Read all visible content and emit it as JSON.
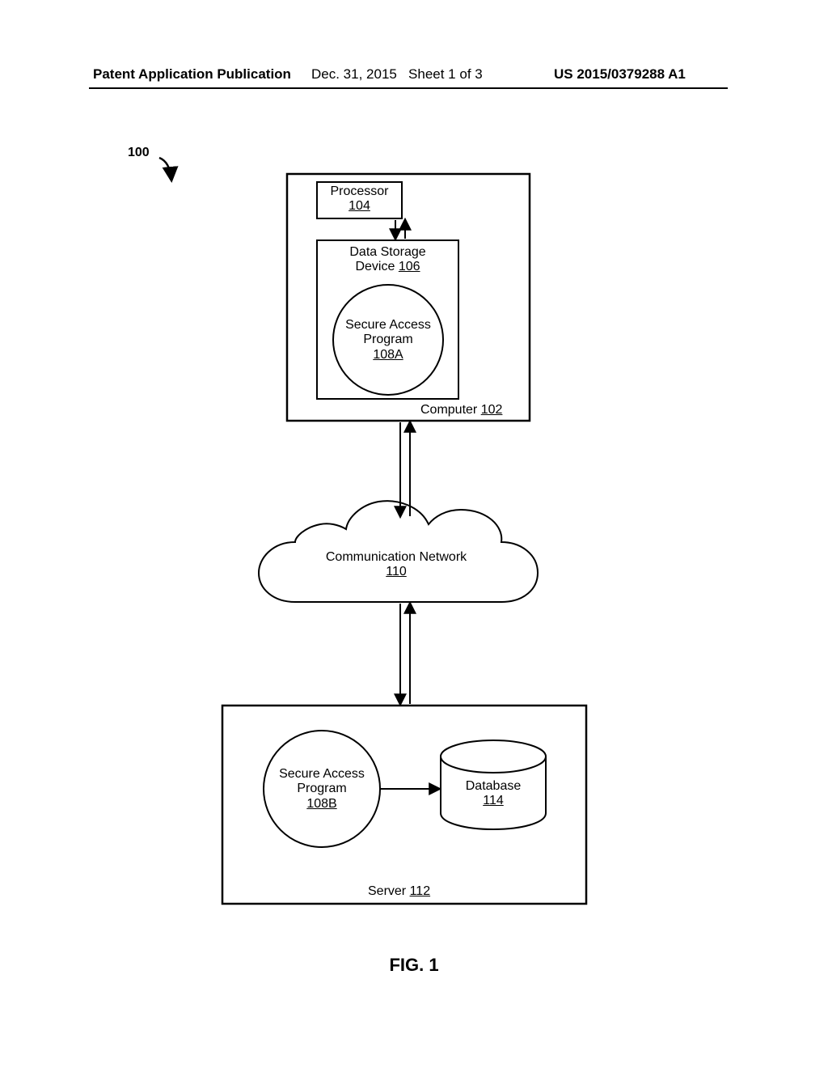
{
  "header": {
    "left": "Patent Application Publication",
    "mid_date": "Dec. 31, 2015",
    "mid_sheet": "Sheet 1 of 3",
    "right": "US 2015/0379288 A1"
  },
  "refnum": "100",
  "computer": {
    "caption_prefix": "Computer ",
    "ref": "102",
    "processor": {
      "label": "Processor",
      "ref": "104"
    },
    "storage": {
      "label_line1": "Data Storage",
      "label_line2_prefix": "Device ",
      "ref": "106"
    },
    "program_a": {
      "line1": "Secure Access",
      "line2": "Program",
      "ref": "108A"
    }
  },
  "network": {
    "label": "Communication Network",
    "ref": "110"
  },
  "server": {
    "caption_prefix": "Server ",
    "ref": "112",
    "program_b": {
      "line1": "Secure Access",
      "line2": "Program",
      "ref": "108B"
    },
    "database": {
      "label": "Database",
      "ref": "114"
    }
  },
  "figure_caption": "FIG. 1"
}
